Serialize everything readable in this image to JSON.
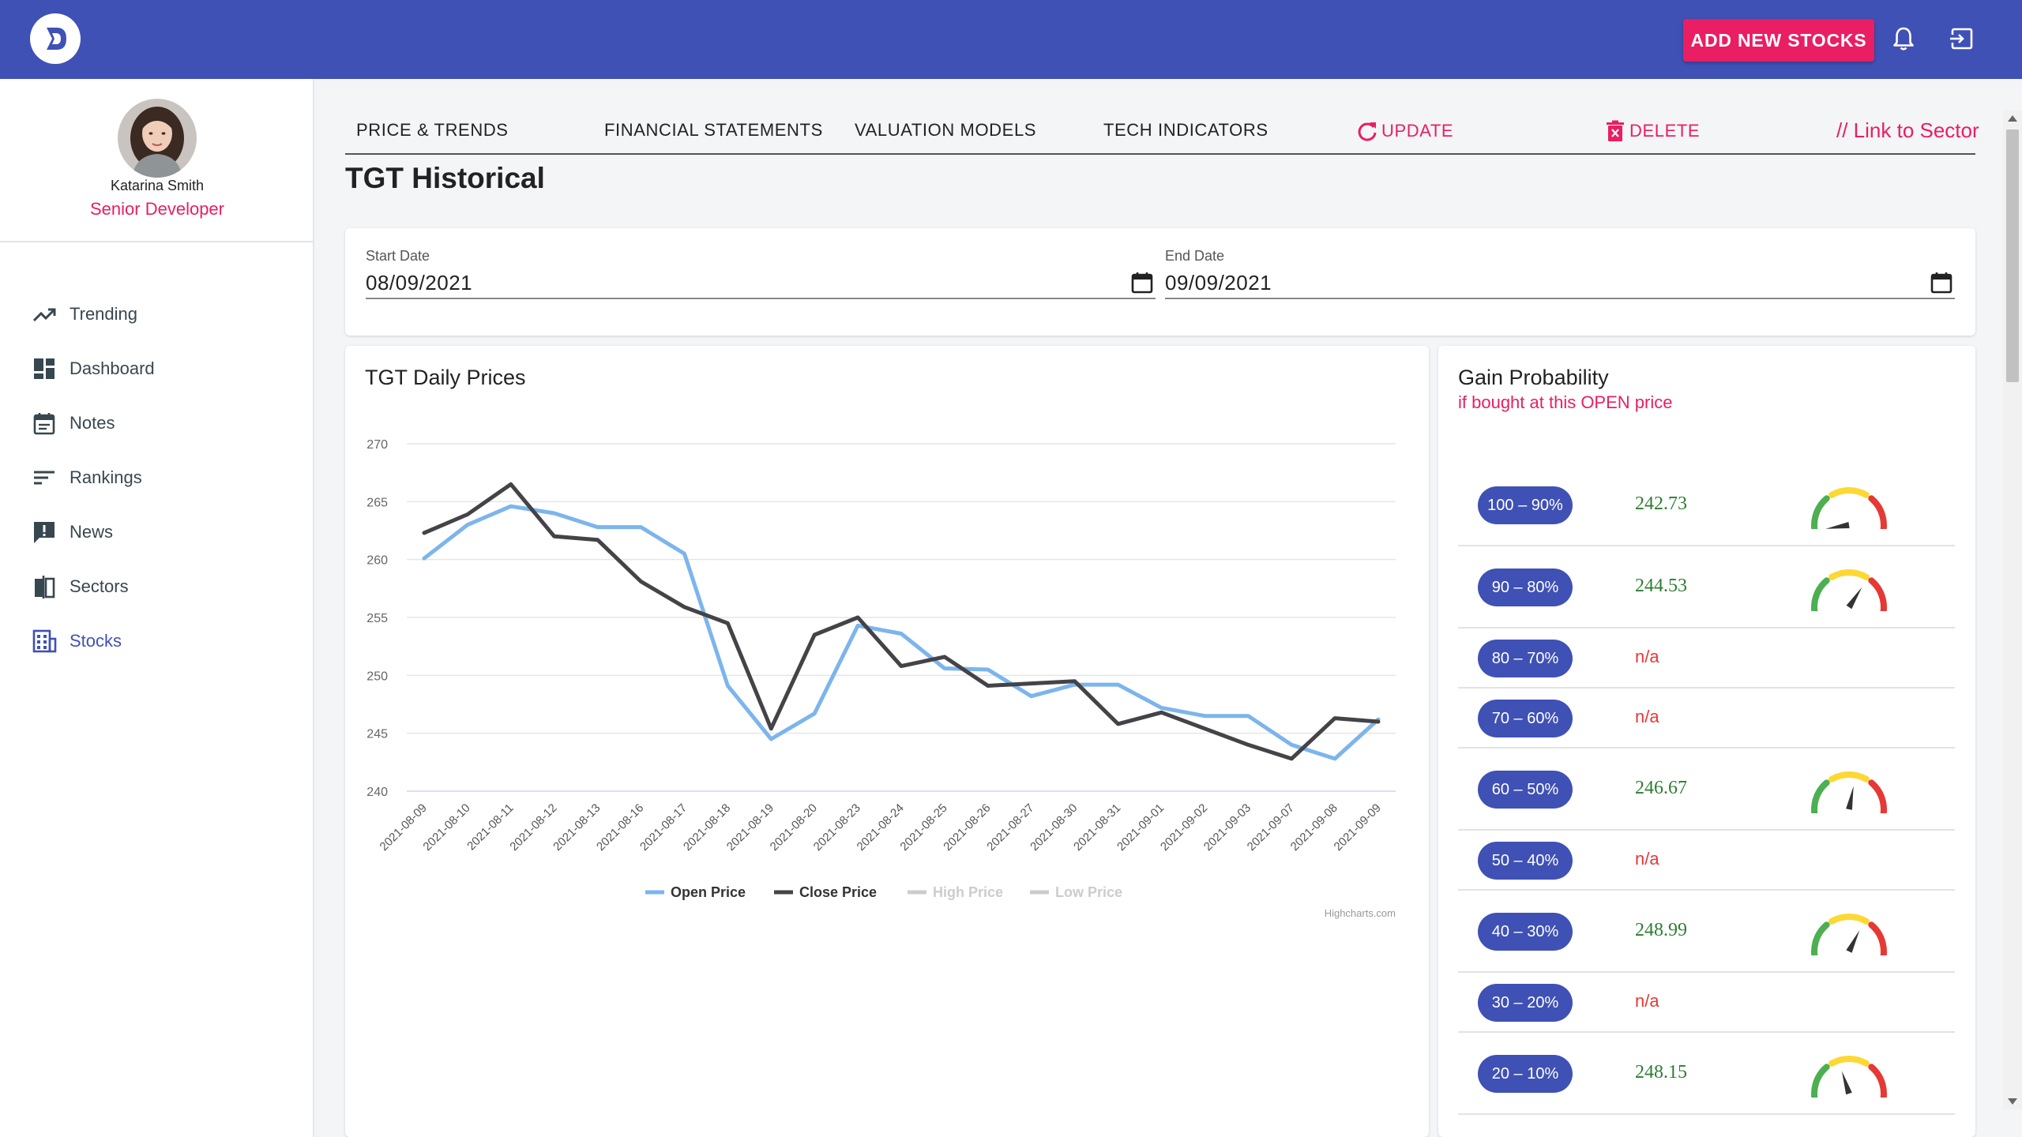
{
  "header": {
    "add_button": "ADD NEW STOCKS",
    "icons": [
      "logo-icon",
      "bell-icon",
      "logout-icon"
    ],
    "colors": {
      "bar": "#3f51b5",
      "accent": "#e91e63"
    }
  },
  "user": {
    "name": "Katarina Smith",
    "role": "Senior Developer"
  },
  "nav": {
    "items": [
      {
        "label": "Trending",
        "icon": "trending-icon"
      },
      {
        "label": "Dashboard",
        "icon": "dashboard-icon"
      },
      {
        "label": "Notes",
        "icon": "notes-icon"
      },
      {
        "label": "Rankings",
        "icon": "rankings-icon"
      },
      {
        "label": "News",
        "icon": "news-icon"
      },
      {
        "label": "Sectors",
        "icon": "sectors-icon"
      },
      {
        "label": "Stocks",
        "icon": "stocks-icon",
        "active": true
      }
    ]
  },
  "tabs": {
    "price": "PRICE & TRENDS",
    "financial": "FINANCIAL STATEMENTS",
    "valuation": "VALUATION MODELS",
    "tech": "TECH INDICATORS",
    "update": "UPDATE",
    "delete": "DELETE",
    "link_sector": "// Link to Sector"
  },
  "page": {
    "title": "TGT Historical"
  },
  "dates": {
    "start_label": "Start Date",
    "start_value": "08/09/2021",
    "end_label": "End Date",
    "end_value": "09/09/2021"
  },
  "chart": {
    "title": "TGT Daily Prices",
    "credit": "Highcharts.com"
  },
  "chart_data": {
    "type": "line",
    "title": "TGT Daily Prices",
    "x": [
      "2021-08-09",
      "2021-08-10",
      "2021-08-11",
      "2021-08-12",
      "2021-08-13",
      "2021-08-16",
      "2021-08-17",
      "2021-08-18",
      "2021-08-19",
      "2021-08-20",
      "2021-08-23",
      "2021-08-24",
      "2021-08-25",
      "2021-08-26",
      "2021-08-27",
      "2021-08-30",
      "2021-08-31",
      "2021-09-01",
      "2021-09-02",
      "2021-09-03",
      "2021-09-07",
      "2021-09-08",
      "2021-09-09"
    ],
    "ylim": [
      240,
      270
    ],
    "yticks": [
      240,
      245,
      250,
      255,
      260,
      265,
      270
    ],
    "grid": true,
    "legend_position": "bottom",
    "series": [
      {
        "name": "Open Price",
        "color": "#7cb5ec",
        "visible": true,
        "values": [
          260.1,
          263.0,
          264.6,
          264.0,
          262.8,
          262.8,
          260.5,
          249.1,
          244.5,
          246.7,
          254.3,
          253.6,
          250.6,
          250.5,
          248.2,
          249.2,
          249.2,
          247.2,
          246.5,
          246.5,
          244.0,
          242.8,
          246.2
        ]
      },
      {
        "name": "Close Price",
        "color": "#434348",
        "visible": true,
        "values": [
          262.3,
          263.9,
          266.5,
          262.0,
          261.7,
          258.1,
          255.9,
          254.5,
          245.4,
          253.5,
          255.0,
          250.8,
          251.6,
          249.1,
          249.3,
          249.5,
          245.8,
          246.8,
          245.4,
          244.0,
          242.8,
          246.3,
          246.0
        ]
      },
      {
        "name": "High Price",
        "color": "#cccccc",
        "visible": false,
        "values": []
      },
      {
        "name": "Low Price",
        "color": "#cccccc",
        "visible": false,
        "values": []
      }
    ]
  },
  "gain": {
    "title": "Gain Probability",
    "subtitle": "if bought at this OPEN price",
    "rows": [
      {
        "range": "100 – 90%",
        "value": "242.73",
        "gauge": 0.05
      },
      {
        "range": "90 – 80%",
        "value": "244.53",
        "gauge": 0.65
      },
      {
        "range": "80 – 70%",
        "value": "n/a"
      },
      {
        "range": "70 – 60%",
        "value": "n/a"
      },
      {
        "range": "60 – 50%",
        "value": "246.67",
        "gauge": 0.55
      },
      {
        "range": "50 – 40%",
        "value": "n/a"
      },
      {
        "range": "40 – 30%",
        "value": "248.99",
        "gauge": 0.62
      },
      {
        "range": "30 – 20%",
        "value": "n/a"
      },
      {
        "range": "20 – 10%",
        "value": "248.15",
        "gauge": 0.42
      }
    ]
  }
}
